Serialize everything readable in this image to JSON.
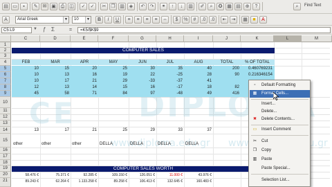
{
  "toolbar": {
    "find_text": "Find Text",
    "font_name": "Arial Greek",
    "font_size": "10"
  },
  "formula_bar": {
    "cell_ref": "C5:L9",
    "formula": "=K5/$K$9"
  },
  "columns": [
    "C",
    "D",
    "E",
    "F",
    "G",
    "H",
    "I",
    "J",
    "K",
    "L",
    "M",
    "N"
  ],
  "rows": [
    "1",
    "2",
    "3",
    "4",
    "5",
    "6",
    "7",
    "8",
    "9",
    "10",
    "11",
    "12",
    "13",
    "14",
    "15",
    "16",
    "17",
    "18",
    "19",
    "20",
    "21"
  ],
  "sheet": {
    "title_computer_sales": "COMPUTER SALES",
    "headers": [
      "FEB",
      "MAR",
      "APR",
      "MAY",
      "JUN",
      "JUL",
      "AUG",
      "TOTAL",
      "% OF TOTAL"
    ],
    "data_rows": [
      [
        "10",
        "15",
        "20",
        "25",
        "30",
        "35",
        "40",
        "200",
        "0.460769231"
      ],
      [
        "10",
        "13",
        "16",
        "19",
        "22",
        "-25",
        "28",
        "90",
        "0.216346154"
      ],
      [
        "10",
        "17",
        "21",
        "29",
        "-33",
        "-37",
        "41",
        "",
        ""
      ],
      [
        "12",
        "13",
        "14",
        "15",
        "16",
        "-17",
        "18",
        "82",
        ""
      ],
      [
        "45",
        "58",
        "71",
        "84",
        "97",
        "-48",
        "49",
        "416",
        ""
      ]
    ],
    "row14": [
      "13",
      "17",
      "21",
      "25",
      "29",
      "33",
      "37",
      "",
      ""
    ],
    "row15": [
      "other",
      "other",
      "other",
      "DELLA",
      "DELLA",
      "DELLA",
      "DELLA",
      "",
      ""
    ],
    "title_sales_worth": "COMPUTER SALES WORTH",
    "row21_partial": [
      "58.476 €",
      "75.371 €",
      "92.285 €",
      "109.150 €",
      "126.051 €",
      "11.000 €",
      "43.976 €",
      "",
      ""
    ],
    "row22_partial": [
      "89.243 €",
      "62.264 €",
      "1.133.258 €",
      "89.258 €",
      "106.413 €",
      "132.645 €",
      "160.483 €",
      "",
      ""
    ]
  },
  "watermark": {
    "w1": "CE",
    "w2": "DIPLOMA",
    "w3": "www.diploma.edu.gr",
    "w4": "www.diploma.edu.gr"
  },
  "context_menu": {
    "items": [
      {
        "label": "Default Formatting",
        "icon": "format-clear-icon"
      },
      {
        "label": "Format Cells...",
        "icon": "format-cells-icon",
        "highlighted": true
      },
      {
        "label": "Insert...",
        "icon": ""
      },
      {
        "label": "Delete...",
        "icon": ""
      },
      {
        "label": "Delete Contents...",
        "icon": "delete-x-icon"
      },
      {
        "label": "Insert Comment",
        "icon": "comment-icon"
      },
      {
        "label": "Cut",
        "icon": "scissors-icon"
      },
      {
        "label": "Copy",
        "icon": "copy-icon"
      },
      {
        "label": "Paste",
        "icon": "paste-icon"
      },
      {
        "label": "Paste Special...",
        "icon": ""
      },
      {
        "label": "Selection List...",
        "icon": ""
      }
    ]
  }
}
